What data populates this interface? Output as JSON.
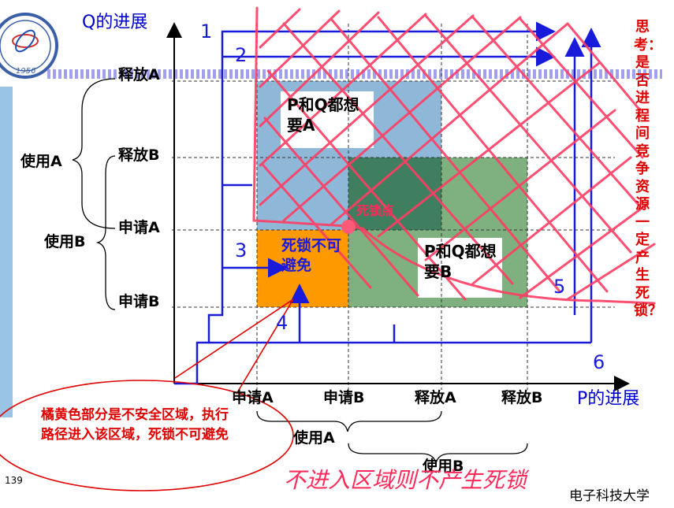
{
  "axes": {
    "y_title": "Q的进展",
    "x_title": "P的进展",
    "y_labels": [
      "释放A",
      "释放B",
      "申请A",
      "申请B"
    ],
    "x_labels": [
      "申请A",
      "申请B",
      "释放A",
      "释放B"
    ]
  },
  "spans": {
    "q_use_a": "使用A",
    "q_use_b": "使用B",
    "p_use_a": "使用A",
    "p_use_b": "使用B"
  },
  "path_numbers": [
    "1",
    "2",
    "3",
    "4",
    "5",
    "6"
  ],
  "regions": {
    "both_need_a": "P和Q都想要A",
    "both_need_b": "P和Q都想要B",
    "deadlock_point": "死锁点",
    "unavoidable": "死锁不可避免"
  },
  "side_question": "思考：是否进程间竞争资源一定产生死锁？",
  "note": "橘黄色部分是不安全区域，执行路径进入该区域，死锁不可避免",
  "handwriting": "不进入区域则不产生死锁",
  "page_number": "139",
  "institution": "电子科技大学",
  "logo_year": "1956",
  "colors": {
    "axis_blue": "#1a1adb",
    "region_blue": "#8fb8d8",
    "region_green": "#5a9a6e",
    "region_dark": "#3f7f5f",
    "region_orange": "#ff9900",
    "red": "#e00000",
    "pink_marker": "#ff3c64"
  }
}
